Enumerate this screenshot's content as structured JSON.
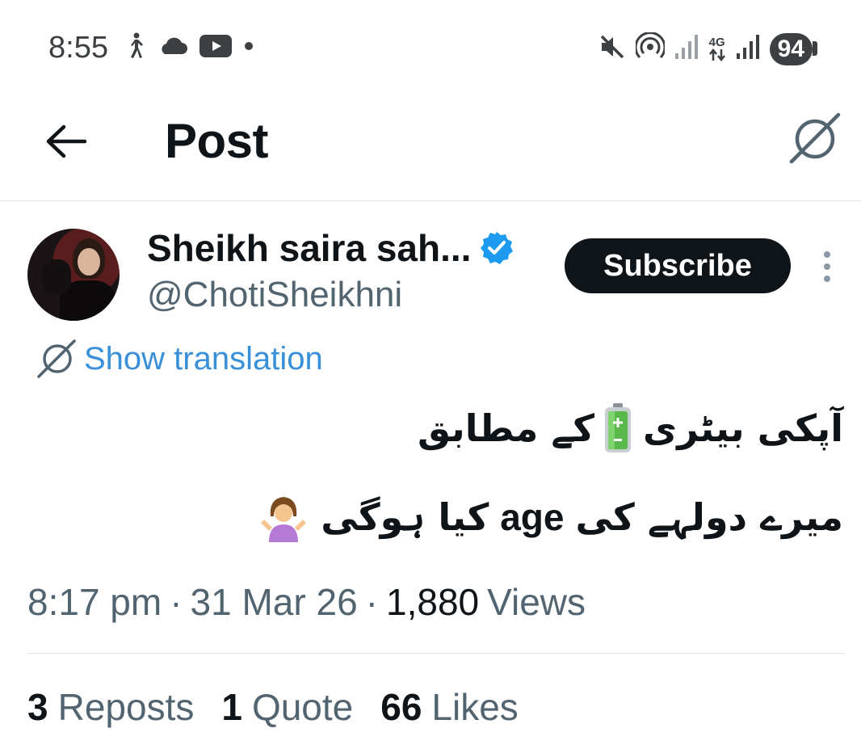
{
  "status_bar": {
    "time": "8:55",
    "battery": "94",
    "network": "4G",
    "left_icons": [
      "walking-icon",
      "cloud-icon",
      "youtube-icon",
      "dot-icon"
    ],
    "right_icons": [
      "mute-icon",
      "hotspot-icon",
      "signal-icon",
      "4g-icon",
      "signal-icon"
    ]
  },
  "header": {
    "title": "Post",
    "back_icon": "arrow-left-icon",
    "translate_icon": "translate-icon"
  },
  "author": {
    "name": "Sheikh saira sah...",
    "handle": "@ChotiSheikhni",
    "verified": true,
    "subscribe_label": "Subscribe"
  },
  "translation": {
    "label": "Show translation"
  },
  "post": {
    "line1_part1": "آپکی بیٹری",
    "line1_emoji": "battery-emoji",
    "line1_part2": "کے مطابق",
    "line2_part1": "میرے دولہے کی",
    "line2_latin": "age",
    "line2_part2": "کیا ہوگی",
    "line2_emoji": "shrugging-woman-emoji"
  },
  "meta": {
    "time": "8:17 pm",
    "sep1": "·",
    "date": "31 Mar 26",
    "sep2": "·",
    "views_count": "1,880",
    "views_label": "Views"
  },
  "stats": {
    "reposts_count": "3",
    "reposts_label": "Reposts",
    "quotes_count": "1",
    "quotes_label": "Quote",
    "likes_count": "66",
    "likes_label": "Likes"
  },
  "colors": {
    "text": "#0f1419",
    "muted": "#536471",
    "link": "#3a8fd9",
    "verified": "#1d9bf0",
    "button_bg": "#0f1419",
    "divider": "#e1e4e6"
  }
}
